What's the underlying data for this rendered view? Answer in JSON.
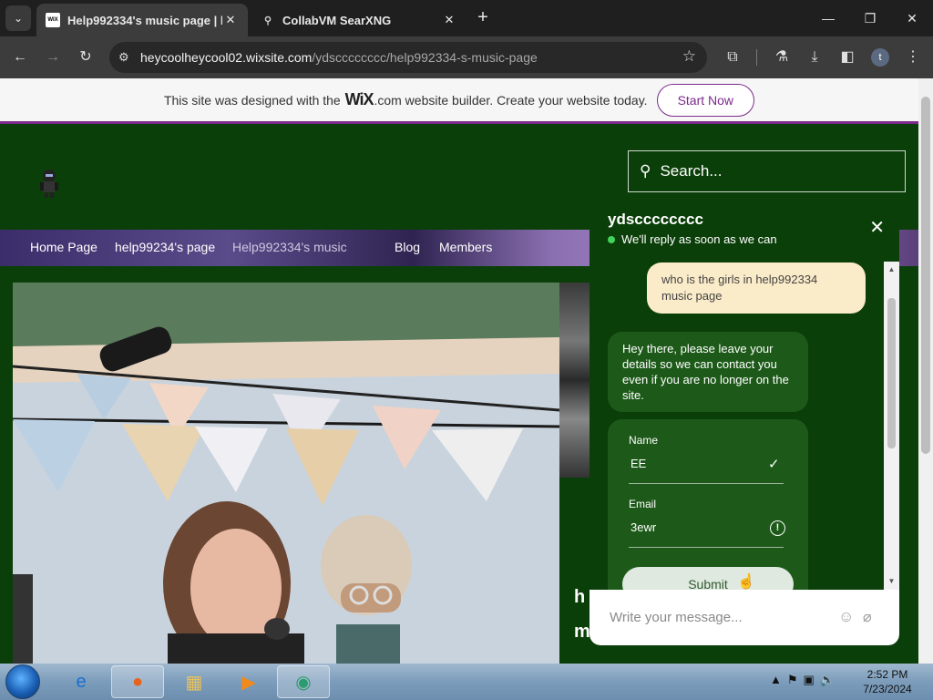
{
  "browser": {
    "tabs": [
      {
        "title": "Help992334's music page | hel",
        "favicon": "WIX",
        "active": true
      },
      {
        "title": "CollabVM SearXNG",
        "favicon": "pin-icon",
        "active": false
      }
    ],
    "url_host": "heycoolheycool02.wixsite.com",
    "url_path": "/ydscccccccc/help992334-s-music-page",
    "profile_initial": "t"
  },
  "wix_banner": {
    "text_before": "This site was designed with the",
    "logo": "WiX",
    "text_after": ".com website builder. Create your website today.",
    "cta": "Start Now"
  },
  "site": {
    "search_placeholder": "Search...",
    "nav": [
      "Home Page",
      "help99234's page",
      "Help992334's music",
      "Blog",
      "Members"
    ],
    "side_text_1": "h",
    "side_text_2": "m"
  },
  "chat": {
    "name": "ydscccccccc",
    "status": "We'll reply as soon as we can",
    "user_message": "who is the girls in help992334 music page",
    "bot_message": "Hey there, please leave your details so we can contact you even if you are no longer on the site.",
    "form": {
      "name_label": "Name",
      "name_value": "EE",
      "email_label": "Email",
      "email_value": "3ewr",
      "submit": "Submit"
    },
    "input_placeholder": "Write your message..."
  },
  "taskbar": {
    "time": "2:52 PM",
    "date": "7/23/2024"
  },
  "colors": {
    "site_green": "#0b3f09",
    "wix_purple": "#7c2a8c",
    "user_bubble": "#fbecc9"
  }
}
